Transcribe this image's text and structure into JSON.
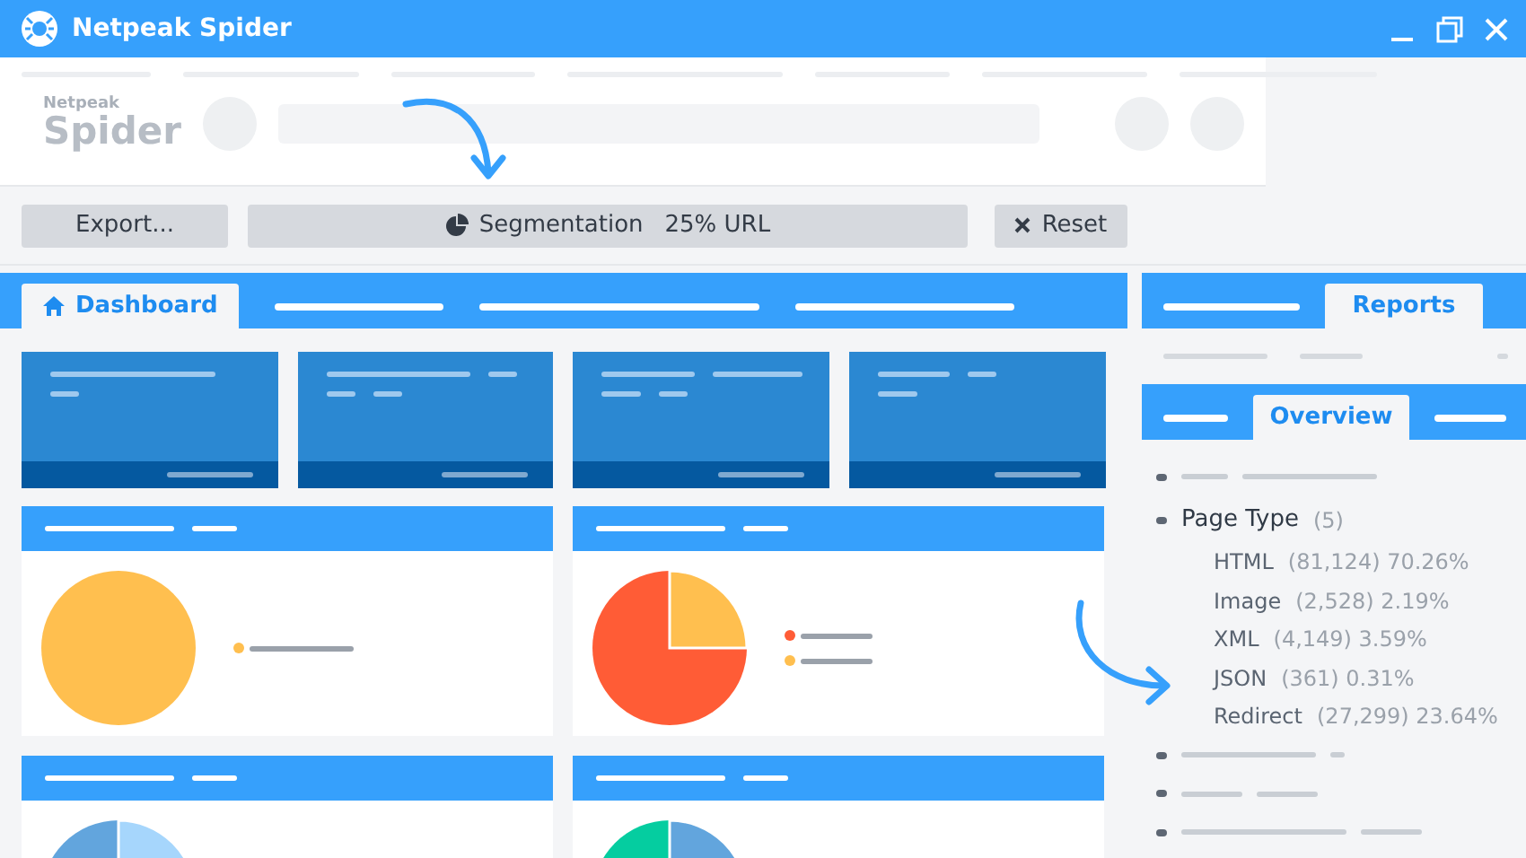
{
  "window": {
    "title": "Netpeak Spider"
  },
  "logo": {
    "top": "Netpeak",
    "bottom": "Spider"
  },
  "toolbar": {
    "export": "Export...",
    "segmentation": {
      "label": "Segmentation",
      "value": "25% URL"
    },
    "reset": "Reset"
  },
  "main_tabs": [
    {
      "label": "Dashboard",
      "selected": true
    }
  ],
  "side_tabs": [
    {
      "label": "Reports",
      "selected": true
    }
  ],
  "sub_tabs": [
    {
      "label": "Overview",
      "selected": true
    }
  ],
  "tree": {
    "label": "Page Type",
    "count": "(5)",
    "children": [
      {
        "name": "HTML",
        "detail": "(81,124) 70.26%"
      },
      {
        "name": "Image",
        "detail": "(2,528) 2.19%"
      },
      {
        "name": "XML",
        "detail": "(4,149) 3.59%"
      },
      {
        "name": "JSON",
        "detail": "(361) 0.31%"
      },
      {
        "name": "Redirect",
        "detail": "(27,299) 23.64%"
      }
    ]
  }
}
